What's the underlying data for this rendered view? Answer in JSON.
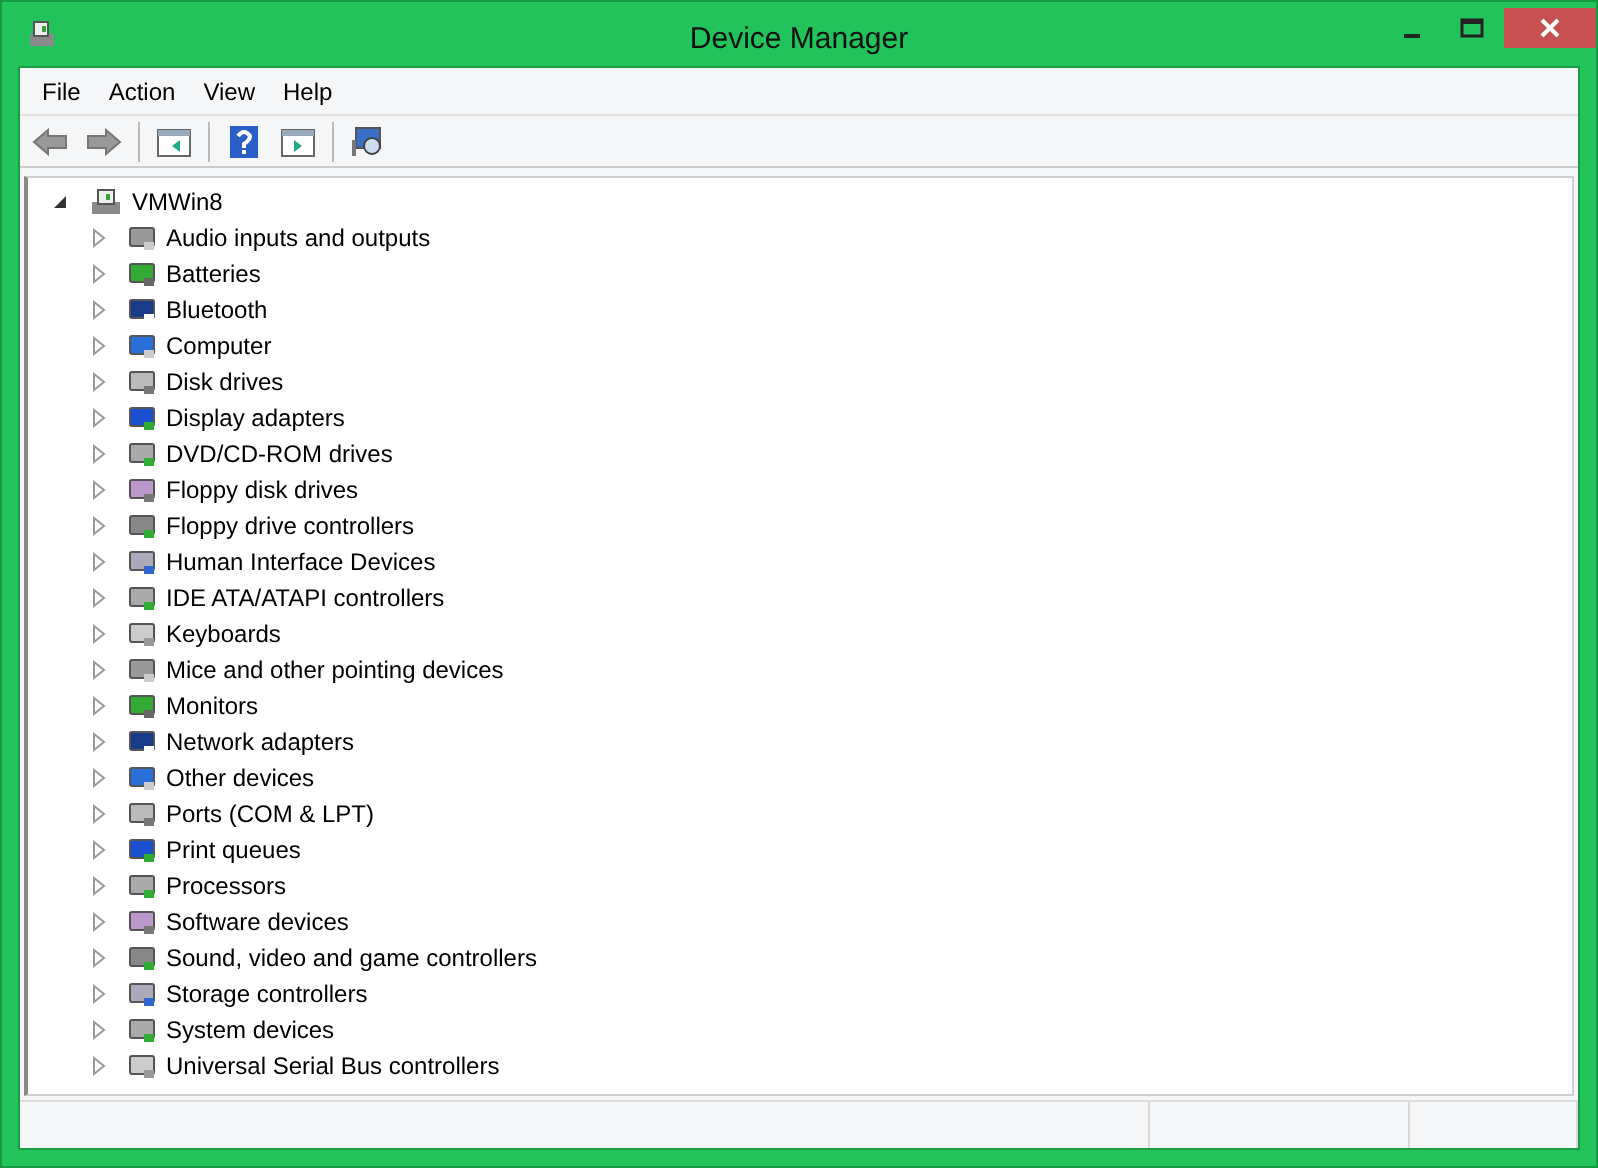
{
  "window": {
    "title": "Device Manager"
  },
  "menu": [
    "File",
    "Action",
    "View",
    "Help"
  ],
  "tree": {
    "label": "VMWin8",
    "expanded": true,
    "children": [
      {
        "label": "Audio inputs and outputs",
        "expanded": false
      },
      {
        "label": "Batteries",
        "expanded": false
      },
      {
        "label": "Bluetooth",
        "expanded": false
      },
      {
        "label": "Computer",
        "expanded": false
      },
      {
        "label": "Disk drives",
        "expanded": false
      },
      {
        "label": "Display adapters",
        "expanded": false
      },
      {
        "label": "DVD/CD-ROM drives",
        "expanded": false
      },
      {
        "label": "Floppy disk drives",
        "expanded": false
      },
      {
        "label": "Floppy drive controllers",
        "expanded": false
      },
      {
        "label": "Human Interface Devices",
        "expanded": false
      },
      {
        "label": "IDE ATA/ATAPI controllers",
        "expanded": false
      },
      {
        "label": "Keyboards",
        "expanded": false
      },
      {
        "label": "Mice and other pointing devices",
        "expanded": false
      },
      {
        "label": "Monitors",
        "expanded": false
      },
      {
        "label": "Network adapters",
        "expanded": false
      },
      {
        "label": "Other devices",
        "expanded": false
      },
      {
        "label": "Ports (COM & LPT)",
        "expanded": false
      },
      {
        "label": "Print queues",
        "expanded": false
      },
      {
        "label": "Processors",
        "expanded": false
      },
      {
        "label": "Software devices",
        "expanded": false
      },
      {
        "label": "Sound, video and game controllers",
        "expanded": false
      },
      {
        "label": "Storage controllers",
        "expanded": false
      },
      {
        "label": "System devices",
        "expanded": false
      },
      {
        "label": "Universal Serial Bus controllers",
        "expanded": false
      }
    ]
  }
}
